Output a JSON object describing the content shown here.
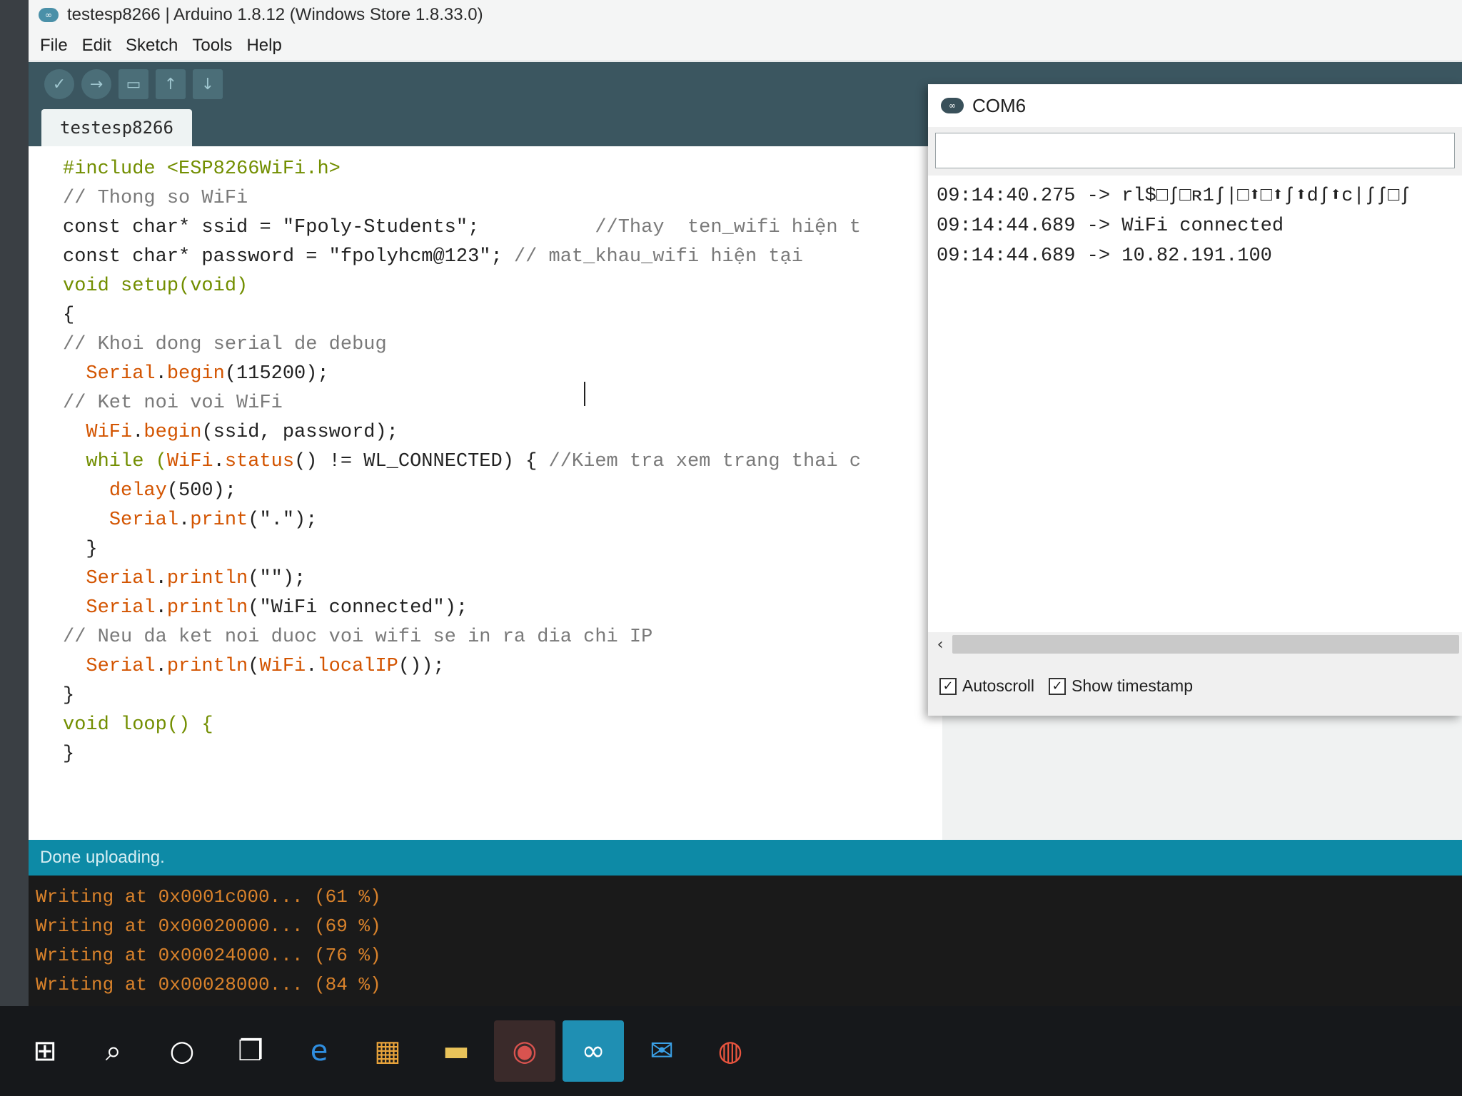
{
  "window": {
    "title": "testesp8266 | Arduino 1.8.12 (Windows Store 1.8.33.0)",
    "icon": "arduino-icon"
  },
  "menu": [
    "File",
    "Edit",
    "Sketch",
    "Tools",
    "Help"
  ],
  "toolbar": {
    "verify": "verify-icon",
    "upload": "upload-icon",
    "new": "new-icon",
    "open": "open-icon",
    "save": "save-icon"
  },
  "tab": {
    "label": "testesp8266"
  },
  "code": {
    "l1": {
      "a": "#include <ESP8266WiFi.h>"
    },
    "l2": {
      "a": "// Thong so WiFi"
    },
    "l3": {
      "a": "const char* ssid = \"Fpoly-Students\";",
      "b": "          //Thay  ten_wifi hiện t"
    },
    "l4": {
      "a": "const char* password = \"fpolyhcm@123\";",
      "b": " // mat_khau_wifi hiện tại"
    },
    "l5": {
      "a": "void setup(void)"
    },
    "l6": {
      "a": "{"
    },
    "l7": {
      "a": "// Khoi dong serial de debug"
    },
    "l8": {
      "a": "  ",
      "fn": "Serial",
      "b": ".",
      "fn2": "begin",
      "c": "(115200);"
    },
    "l9": {
      "a": "// Ket noi voi WiFi"
    },
    "l10": {
      "a": "  ",
      "fn": "WiFi",
      "b": ".",
      "fn2": "begin",
      "c": "(ssid, password);"
    },
    "l11": {
      "a": "  while (",
      "fn": "WiFi",
      "b": ".",
      "fn2": "status",
      "c": "() != WL_CONNECTED) {",
      "cm": " //Kiem tra xem trang thai c"
    },
    "l12": {
      "a": "    ",
      "fn": "delay",
      "c": "(500);"
    },
    "l13": {
      "a": "    ",
      "fn": "Serial",
      "b": ".",
      "fn2": "print",
      "c": "(\".\");"
    },
    "l14": {
      "a": "  }"
    },
    "l15": {
      "a": "  ",
      "fn": "Serial",
      "b": ".",
      "fn2": "println",
      "c": "(\"\");"
    },
    "l16": {
      "a": "  ",
      "fn": "Serial",
      "b": ".",
      "fn2": "println",
      "c": "(\"WiFi connected\");"
    },
    "l17": {
      "a": "// Neu da ket noi duoc voi wifi se in ra dia chi IP"
    },
    "l18": {
      "a": "  ",
      "fn": "Serial",
      "b": ".",
      "fn2": "println",
      "c": "(",
      "fn3": "WiFi",
      "d": ".",
      "fn4": "localIP",
      "e": "());"
    },
    "l19": {
      "a": "}"
    },
    "l20": {
      "a": "void loop() {"
    },
    "l21": {
      "a": "}"
    }
  },
  "status": {
    "text": "Done uploading."
  },
  "console": [
    "Writing at 0x0001c000... (61 %)",
    "Writing at 0x00020000... (69 %)",
    "Writing at 0x00024000... (76 %)",
    "Writing at 0x00028000... (84 %)"
  ],
  "serial_monitor": {
    "title": "COM6",
    "input_value": "",
    "lines": [
      "09:14:40.275 -> rl$□ʃ□ʀ1ʃ|□⬆□⬆ʃ⬆dʃ⬆c|ʃʃ□ʃ",
      "09:14:44.689 -> WiFi connected",
      "09:14:44.689 -> 10.82.191.100"
    ],
    "scroll_left": "‹",
    "autoscroll": {
      "label": "Autoscroll",
      "checked": true
    },
    "show_timestamp": {
      "label": "Show timestamp",
      "checked": true
    },
    "check_mark": "✓"
  },
  "taskbar": {
    "start": "windows-start-icon",
    "search": "search-icon",
    "cortana": "cortana-icon",
    "task_view": "task-view-icon",
    "edge": "edge-icon",
    "store": "store-icon",
    "explorer": "file-explorer-icon",
    "app1": "app-icon",
    "arduino": "arduino-icon",
    "mail": "mail-icon",
    "chrome": "chrome-icon"
  },
  "colors": {
    "toolbar": "#3b5660",
    "status_bar": "#0d8aa6",
    "console_text": "#d9822b",
    "keyword": "#728e00",
    "function": "#d35400"
  }
}
